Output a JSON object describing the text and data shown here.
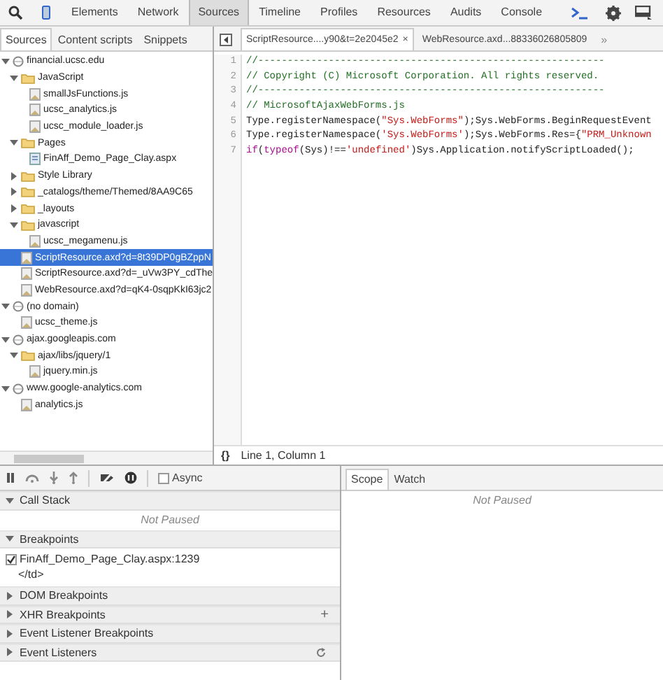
{
  "main_tabs": [
    {
      "label": "Elements",
      "selected": false
    },
    {
      "label": "Network",
      "selected": false
    },
    {
      "label": "Sources",
      "selected": true
    },
    {
      "label": "Timeline",
      "selected": false
    },
    {
      "label": "Profiles",
      "selected": false
    },
    {
      "label": "Resources",
      "selected": false
    },
    {
      "label": "Audits",
      "selected": false
    },
    {
      "label": "Console",
      "selected": false
    }
  ],
  "navigator": {
    "tabs": [
      {
        "label": "Sources",
        "selected": true
      },
      {
        "label": "Content scripts",
        "selected": false
      },
      {
        "label": "Snippets",
        "selected": false
      }
    ],
    "tree": [
      {
        "kind": "domain",
        "label": "financial.ucsc.edu",
        "expanded": true,
        "selected": false,
        "children": [
          {
            "kind": "folder",
            "label": "JavaScript",
            "expanded": true,
            "selected": false,
            "children": [
              {
                "kind": "file",
                "label": "smallJsFunctions.js",
                "selected": false
              },
              {
                "kind": "file",
                "label": "ucsc_analytics.js",
                "selected": false
              },
              {
                "kind": "file",
                "label": "ucsc_module_loader.js",
                "selected": false
              }
            ]
          },
          {
            "kind": "folder",
            "label": "Pages",
            "expanded": true,
            "selected": false,
            "children": [
              {
                "kind": "page",
                "label": "FinAff_Demo_Page_Clay.aspx",
                "selected": false
              }
            ]
          },
          {
            "kind": "folder",
            "label": "Style Library",
            "expanded": false,
            "selected": false
          },
          {
            "kind": "folder",
            "label": "_catalogs/theme/Themed/8AA9C65",
            "expanded": false,
            "selected": false
          },
          {
            "kind": "folder",
            "label": "_layouts",
            "expanded": false,
            "selected": false
          },
          {
            "kind": "folder",
            "label": "javascript",
            "expanded": true,
            "selected": false,
            "children": [
              {
                "kind": "file",
                "label": "ucsc_megamenu.js",
                "selected": false
              }
            ]
          },
          {
            "kind": "file",
            "label": "ScriptResource.axd?d=8t39DP0gBZppN",
            "selected": true
          },
          {
            "kind": "file",
            "label": "ScriptResource.axd?d=_uVw3PY_cdThe",
            "selected": false
          },
          {
            "kind": "file",
            "label": "WebResource.axd?d=qK4-0sqpKkI63jc2",
            "selected": false
          }
        ]
      },
      {
        "kind": "domain",
        "label": "(no domain)",
        "expanded": true,
        "selected": false,
        "children": [
          {
            "kind": "file",
            "label": "ucsc_theme.js",
            "selected": false
          }
        ]
      },
      {
        "kind": "domain",
        "label": "ajax.googleapis.com",
        "expanded": true,
        "selected": false,
        "children": [
          {
            "kind": "folder",
            "label": "ajax/libs/jquery/1",
            "expanded": true,
            "selected": false,
            "children": [
              {
                "kind": "file",
                "label": "jquery.min.js",
                "selected": false
              }
            ]
          }
        ]
      },
      {
        "kind": "domain",
        "label": "www.google-analytics.com",
        "expanded": true,
        "selected": false,
        "children": [
          {
            "kind": "file",
            "label": "analytics.js",
            "selected": false
          }
        ]
      }
    ]
  },
  "editor": {
    "tabs": [
      {
        "label": "ScriptResource....y90&t=2e2045e2",
        "close": "×",
        "selected": true
      },
      {
        "label": "WebResource.axd...88336026805809",
        "selected": false
      }
    ],
    "overflow": "»",
    "lines": [
      {
        "number": "1",
        "tokens": [
          {
            "kind": "comment",
            "text": "//-----------------------------------------------------------"
          }
        ]
      },
      {
        "number": "2",
        "tokens": [
          {
            "kind": "comment",
            "text": "// Copyright (C) Microsoft Corporation. All rights reserved."
          }
        ]
      },
      {
        "number": "3",
        "tokens": [
          {
            "kind": "comment",
            "text": "//-----------------------------------------------------------"
          }
        ]
      },
      {
        "number": "4",
        "tokens": [
          {
            "kind": "comment",
            "text": "// MicrosoftAjaxWebForms.js"
          }
        ]
      },
      {
        "number": "5",
        "tokens": [
          {
            "kind": "plain",
            "text": "Type.registerNamespace("
          },
          {
            "kind": "string",
            "text": "\"Sys.WebForms\""
          },
          {
            "kind": "plain",
            "text": ");Sys.WebForms.BeginRequestEvent"
          }
        ]
      },
      {
        "number": "6",
        "tokens": [
          {
            "kind": "plain",
            "text": "Type.registerNamespace("
          },
          {
            "kind": "string",
            "text": "'Sys.WebForms'"
          },
          {
            "kind": "plain",
            "text": ");Sys.WebForms.Res={"
          },
          {
            "kind": "string",
            "text": "\"PRM_Unknown"
          }
        ]
      },
      {
        "number": "7",
        "tokens": [
          {
            "kind": "keyword",
            "text": "if"
          },
          {
            "kind": "plain",
            "text": "("
          },
          {
            "kind": "keyword",
            "text": "typeof"
          },
          {
            "kind": "plain",
            "text": "(Sys)!=="
          },
          {
            "kind": "string",
            "text": "'undefined'"
          },
          {
            "kind": "plain",
            "text": ")Sys.Application.notifyScriptLoaded();"
          }
        ]
      }
    ],
    "pretty_print": "{}",
    "position": "Line 1, Column 1"
  },
  "debugger": {
    "async": {
      "label": "Async",
      "checked": false
    },
    "sections": [
      {
        "title": "Call Stack",
        "expanded": true,
        "message": "Not Paused"
      },
      {
        "title": "Breakpoints",
        "expanded": true,
        "breakpoints": [
          {
            "location": "FinAff_Demo_Page_Clay.aspx:1239",
            "code": "</td>",
            "checked": true
          }
        ]
      },
      {
        "title": "DOM Breakpoints",
        "expanded": false
      },
      {
        "title": "XHR Breakpoints",
        "expanded": false,
        "action": "+"
      },
      {
        "title": "Event Listener Breakpoints",
        "expanded": false
      },
      {
        "title": "Event Listeners",
        "expanded": false,
        "refresh": true
      }
    ]
  },
  "sidebar": {
    "tabs": [
      {
        "label": "Scope",
        "selected": true
      },
      {
        "label": "Watch",
        "selected": false
      }
    ],
    "message": "Not Paused"
  }
}
